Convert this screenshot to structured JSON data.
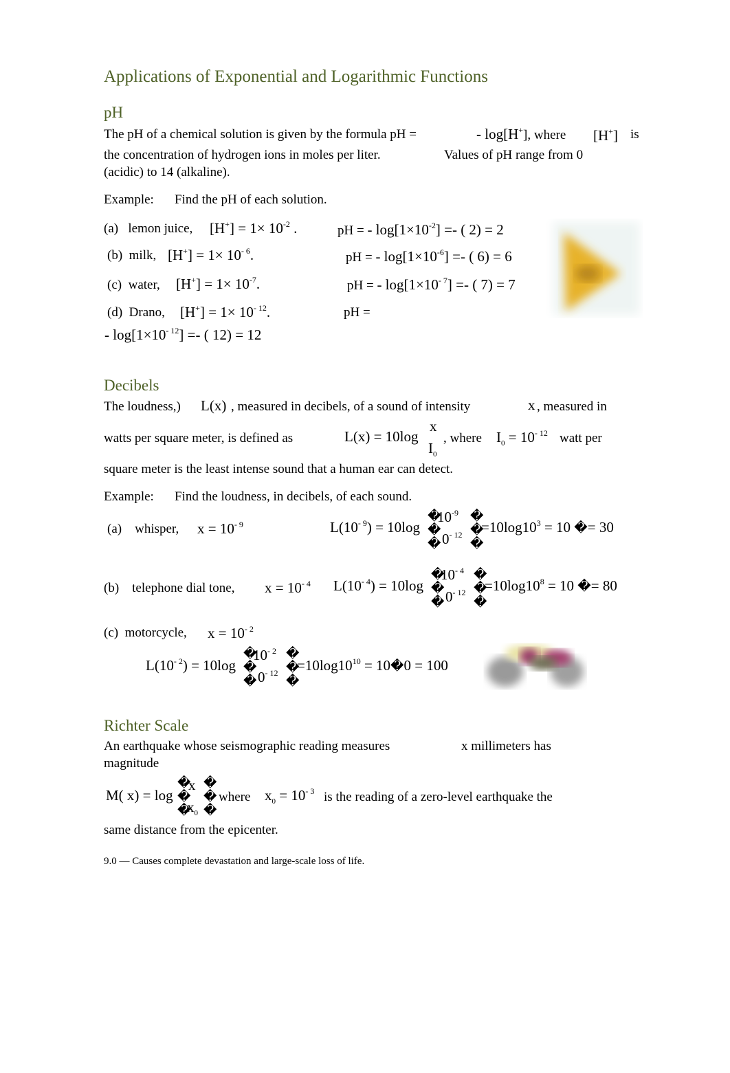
{
  "title": "Applications of Exponential and Logarithmic Functions",
  "ph": {
    "heading": "pH",
    "intro_line1_a": "The pH of a chemical solution is given by the formula pH =",
    "intro_formula": "- log[H",
    "intro_formula_sup": "+",
    "intro_formula_close": "], where",
    "intro_h": "[H",
    "intro_h_sup": "+",
    "intro_h_close": "]",
    "intro_is": "is",
    "intro_line2_a": "the concentration of hydrogen ions in moles per liter.",
    "intro_line2_b": "Values of pH range from 0",
    "intro_line3": "(acidic) to 14 (alkaline).",
    "example_label": "Example:",
    "example_text": "Find the pH of each solution.",
    "examples": [
      {
        "label": "(a)",
        "name": "lemon juice,",
        "conc": "[H",
        "conc_sup": "+",
        "conc_eq": "] = 1× 10",
        "conc_exp": "-2",
        "conc_end": ".",
        "ph_label": "pH =",
        "ph_calc": "- log[1×10",
        "ph_exp": "-2",
        "ph_rest": "] =- ( 2) = 2"
      },
      {
        "label": "(b)",
        "name": "milk,",
        "conc": "[H",
        "conc_sup": "+",
        "conc_eq": "] = 1× 10",
        "conc_exp": "- 6",
        "conc_end": ".",
        "ph_label": "pH =",
        "ph_calc": "- log[1×10",
        "ph_exp": "-6",
        "ph_rest": "] =- ( 6) = 6"
      },
      {
        "label": "(c)",
        "name": "water,",
        "conc": "[H",
        "conc_sup": "+",
        "conc_eq": "] = 1× 10",
        "conc_exp": "-7",
        "conc_end": ".",
        "ph_label": "pH =",
        "ph_calc": "- log[1×10",
        "ph_exp": "- 7",
        "ph_rest": "] =- ( 7) = 7"
      },
      {
        "label": "(d)",
        "name": "Drano,",
        "conc": "[H",
        "conc_sup": "+",
        "conc_eq": "] = 1× 10",
        "conc_exp": "- 12",
        "conc_end": ".",
        "ph_label": "pH =",
        "ph_calc": "- log[1×10",
        "ph_exp": "- 12",
        "ph_rest": "] =- ( 12) = 12"
      }
    ],
    "image_icon": "lemon-image"
  },
  "decibels": {
    "heading": "Decibels",
    "line1_a": "The loudness,)",
    "line1_fx": "L(x)",
    "line1_b": ", measured in decibels, of a sound of intensity",
    "line1_x": "x",
    "line1_c": ", measured in",
    "line2_a": "watts per square meter, is defined as",
    "line2_formula": "L(x) = 10log",
    "line2_num": "x",
    "line2_den": "I",
    "line2_den_sub": "0",
    "line2_where": ", where",
    "line2_i0": "I",
    "line2_i0_sub": "0",
    "line2_i0_eq": "= 10",
    "line2_i0_exp": "- 12",
    "line2_end": "watt per",
    "line3": "square meter is the least intense sound that a human ear can detect.",
    "example_label": "Example:",
    "example_text": "Find the loudness, in decibels, of each sound.",
    "examples": [
      {
        "label": "(a)",
        "name": "whisper,",
        "x_eq": "x = 10",
        "x_exp": "- 9",
        "calc_l": "L(10",
        "calc_l_exp": "- 9",
        "calc_l_close": ") = 10log",
        "num": "10",
        "num_exp": "-9",
        "den": "0",
        "den_exp": "- 12",
        "rest": "10log10",
        "rest_exp": "3",
        "rest2": "= 10",
        "rest3": "= 30"
      },
      {
        "label": "(b)",
        "name": "telephone dial tone,",
        "x_eq": "x = 10",
        "x_exp": "- 4",
        "calc_l": "L(10",
        "calc_l_exp": "- 4",
        "calc_l_close": ") = 10log",
        "num": "10",
        "num_exp": "- 4",
        "den": "0",
        "den_exp": "- 12",
        "rest": "10log10",
        "rest_exp": "8",
        "rest2": "= 10",
        "rest3": "= 80"
      },
      {
        "label": "(c)",
        "name": "motorcycle,",
        "x_eq": "x = 10",
        "x_exp": "- 2",
        "calc_l": "L(10",
        "calc_l_exp": "- 2",
        "calc_l_close": ") = 10log",
        "num": "10",
        "num_exp": "- 2",
        "den": "0",
        "den_exp": "- 12",
        "rest": "10log10",
        "rest_exp": "10",
        "rest2": "= 10",
        "rest3": "0 = 100"
      }
    ],
    "replacement_char": "�",
    "image_icon": "motorcycle-image"
  },
  "richter": {
    "heading": "Richter Scale",
    "line1_a": "An earthquake whose seismographic reading measures",
    "line1_b": "x millimeters has",
    "line2": "magnitude",
    "formula": "M( x) = log",
    "num": "x",
    "den": "x",
    "den_sub": "0",
    "where": "where",
    "x0": "x",
    "x0_sub": "0",
    "x0_eq": "= 10",
    "x0_exp": "- 3",
    "line3_rest": "is the reading of a zero-level earthquake the",
    "line4": "same distance from the epicenter."
  },
  "footnote": "9.0 — Causes complete devastation and large-scale loss of life."
}
